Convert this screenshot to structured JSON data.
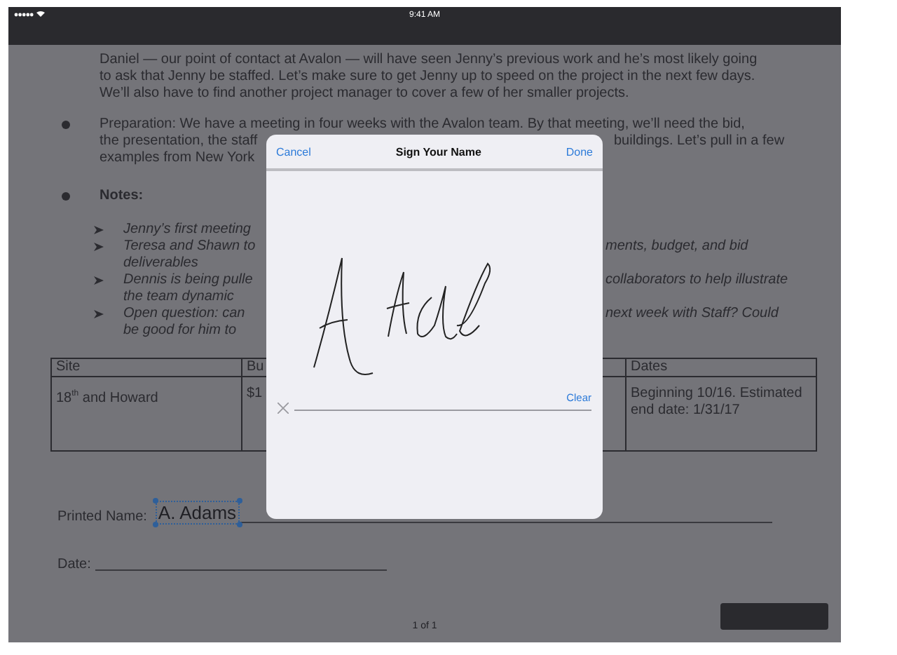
{
  "status_bar": {
    "time": "9:41 AM"
  },
  "document": {
    "blocks": [
      {
        "kind": "paragraph",
        "bullet": false,
        "lines": [
          {
            "left": "Daniel — our point of contact at Avalon — will have seen Jenny’s previous work and he’s most likely going"
          },
          {
            "left": "to ask that Jenny be staffed. Let’s make sure to get Jenny up to speed on the project in the next few days."
          },
          {
            "left": "We’ll also have to find another project manager to cover a few of her smaller projects."
          }
        ]
      },
      {
        "kind": "paragraph",
        "bullet": true,
        "lines": [
          {
            "left": "Preparation: We have a meeting in four weeks with the Avalon team. By that meeting, we’ll need the bid,"
          },
          {
            "left": "the presentation, the staff",
            "right": "buildings. Let’s pull in a few"
          },
          {
            "left": "examples from New York"
          }
        ]
      },
      {
        "kind": "heading",
        "bullet": true,
        "lines": [
          {
            "left": "Notes:"
          }
        ]
      },
      {
        "kind": "sublist",
        "items": [
          {
            "lines": [
              {
                "left": "Jenny’s first meeting"
              }
            ]
          },
          {
            "lines": [
              {
                "left": "Teresa and Shawn to",
                "right": "ments, budget, and bid"
              },
              {
                "left": "deliverables"
              }
            ]
          },
          {
            "lines": [
              {
                "left": "Dennis is being pulle",
                "right": "collaborators to help illustrate"
              },
              {
                "left": "the team dynamic"
              }
            ]
          },
          {
            "lines": [
              {
                "left": "Open question: can",
                "right": "next week with Staff? Could"
              },
              {
                "left": "be good for him to"
              }
            ]
          }
        ]
      }
    ],
    "table": {
      "columns": [
        "Site",
        "Bu",
        "Dates"
      ],
      "rows": [
        [
          "18$^{th}$ and Howard",
          "$1",
          "Beginning 10/16. Estimated end date: 1/31/17"
        ]
      ]
    },
    "form": {
      "printed_name_label": "Printed Name:",
      "printed_name": {
        "value": "A. Adams",
        "selected": true
      },
      "date_label": "Date:"
    },
    "page_indicator": "1 of 1"
  },
  "dialog": {
    "cancel": "Cancel",
    "title": "Sign Your Name",
    "done": "Done",
    "clear": "Clear"
  }
}
